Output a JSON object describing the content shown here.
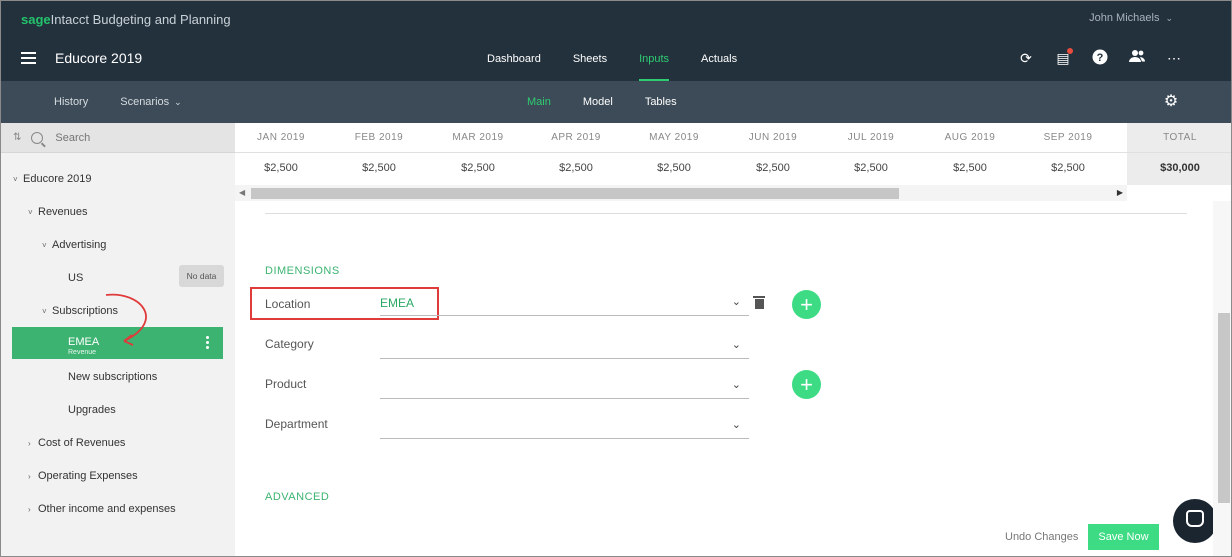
{
  "brand": {
    "sage": "sage",
    "intacct": "Intacct",
    "product": "Budgeting and Planning"
  },
  "user": {
    "name": "John Michaels"
  },
  "nav": {
    "title": "Educore 2019",
    "tabs": [
      "Dashboard",
      "Sheets",
      "Inputs",
      "Actuals"
    ],
    "active_tab": "Inputs",
    "icons": [
      "refresh-icon",
      "clipboard-icon",
      "help-icon",
      "people-icon",
      "more-icon"
    ]
  },
  "subnav": {
    "history": "History",
    "scenarios": "Scenarios",
    "tabs": [
      "Main",
      "Model",
      "Tables"
    ],
    "active_tab": "Main"
  },
  "sidebar": {
    "search_placeholder": "Search",
    "tree": {
      "root": "Educore 2019",
      "revenues": "Revenues",
      "advertising": "Advertising",
      "us": "US",
      "nodata": "No data",
      "subscriptions": "Subscriptions",
      "emea": "EMEA",
      "emea_sub": "Revenue",
      "new_subs": "New subscriptions",
      "upgrades": "Upgrades",
      "cost_rev": "Cost of Revenues",
      "opex": "Operating Expenses",
      "other": "Other income and expenses"
    }
  },
  "grid": {
    "months": [
      "JAN 2019",
      "FEB 2019",
      "MAR 2019",
      "APR 2019",
      "MAY 2019",
      "JUN 2019",
      "JUL 2019",
      "AUG 2019",
      "SEP 2019"
    ],
    "values": [
      "$2,500",
      "$2,500",
      "$2,500",
      "$2,500",
      "$2,500",
      "$2,500",
      "$2,500",
      "$2,500",
      "$2,500"
    ],
    "total_label": "TOTAL",
    "total_value": "$30,000"
  },
  "dimensions": {
    "title": "DIMENSIONS",
    "location_label": "Location",
    "location_value": "EMEA",
    "category_label": "Category",
    "product_label": "Product",
    "department_label": "Department"
  },
  "advanced": {
    "title": "ADVANCED"
  },
  "footer": {
    "undo": "Undo Changes",
    "save": "Save Now"
  },
  "colors": {
    "accent": "#2ecc71",
    "header": "#23313d",
    "subheader": "#3c4b57",
    "highlight": "#e03b3b"
  }
}
